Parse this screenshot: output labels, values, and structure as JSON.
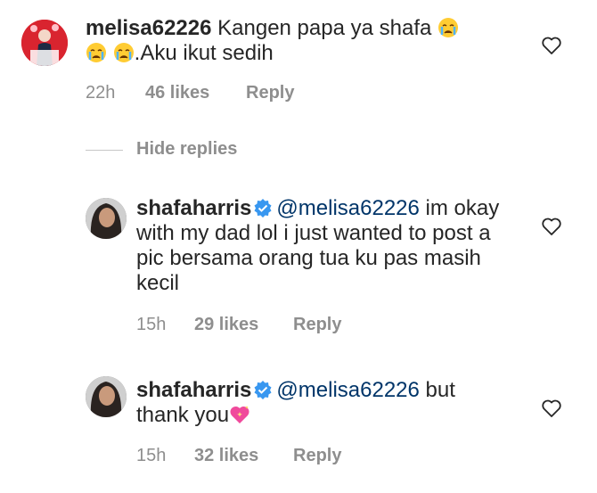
{
  "comments": [
    {
      "username": "melisa62226",
      "text_line1": "Kangen papa ya shafa",
      "text_line2": ".Aku ikut sedih",
      "time": "22h",
      "likes": "46 likes",
      "reply": "Reply"
    },
    {
      "username": "shafaharris",
      "mention": "@melisa62226",
      "text": " im okay with my dad lol i just wanted to post a pic bersama orang tua ku pas masih kecil",
      "time": "15h",
      "likes": "29 likes",
      "reply": "Reply"
    },
    {
      "username": "shafaharris",
      "mention": "@melisa62226",
      "text_line1": " but",
      "text_line2": "thank you",
      "time": "15h",
      "likes": "32 likes",
      "reply": "Reply"
    }
  ],
  "hide_replies": "Hide replies",
  "colors": {
    "text": "#262626",
    "meta": "#8e8e8e",
    "mention": "#003569",
    "verified": "#3897f0",
    "avatar_bg": "#d9242f"
  },
  "icons": [
    "heart-outline-icon",
    "verified-badge-icon",
    "crying-face-emoji",
    "sparkling-heart-emoji"
  ]
}
